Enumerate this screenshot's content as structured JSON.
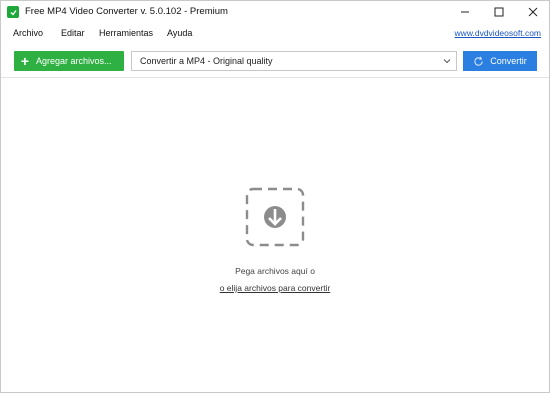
{
  "window": {
    "title": "Free MP4 Video Converter v. 5.0.102 - Premium",
    "controls": {
      "minimize": "—",
      "maximize": "☐",
      "close": "✕"
    }
  },
  "menu": {
    "items": [
      "Archivo",
      "Editar",
      "Herramientas",
      "Ayuda"
    ],
    "site_link": "www.dvdvideosoft.com"
  },
  "toolbar": {
    "add_label": "Agregar archivos...",
    "format_value": "Convertir a MP4 - Original quality",
    "convert_label": "Convertir"
  },
  "drop_area": {
    "hint": "Pega archivos aquí o",
    "link": "o elija archivos para convertir"
  },
  "colors": {
    "add_button": "#2fb042",
    "convert_button": "#2a7fe0",
    "app_icon": "#1fa83a",
    "link": "#1a56c4"
  },
  "icons": {
    "app": "app-logo-icon",
    "add": "plus-icon",
    "dropdown": "chevron-down-icon",
    "convert": "refresh-icon",
    "drop": "download-arrow-icon"
  }
}
